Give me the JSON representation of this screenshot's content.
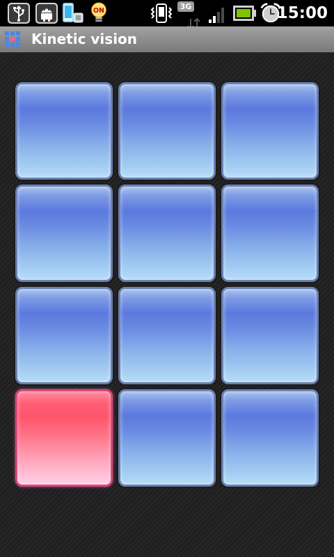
{
  "status_bar": {
    "time": "15:00",
    "network_type": "3G",
    "notification_badge": "ON",
    "icons": [
      "usb-icon",
      "android-debug-icon",
      "phone-storage-icon",
      "lightbulb-on-icon",
      "vibrate-icon",
      "data-arrows-icon",
      "signal-icon",
      "battery-icon",
      "alarm-clock-icon"
    ]
  },
  "app": {
    "title": "Kinetic vision",
    "icon": "grid-app-icon"
  },
  "grid": {
    "rows": 4,
    "columns": 3,
    "active_tile": 10,
    "tiles": [
      {
        "state": "idle"
      },
      {
        "state": "idle"
      },
      {
        "state": "idle"
      },
      {
        "state": "idle"
      },
      {
        "state": "idle"
      },
      {
        "state": "idle"
      },
      {
        "state": "idle"
      },
      {
        "state": "idle"
      },
      {
        "state": "idle"
      },
      {
        "state": "active"
      },
      {
        "state": "idle"
      },
      {
        "state": "idle"
      }
    ],
    "colors": {
      "idle": "#5b79de",
      "active": "#ff5c72"
    }
  }
}
